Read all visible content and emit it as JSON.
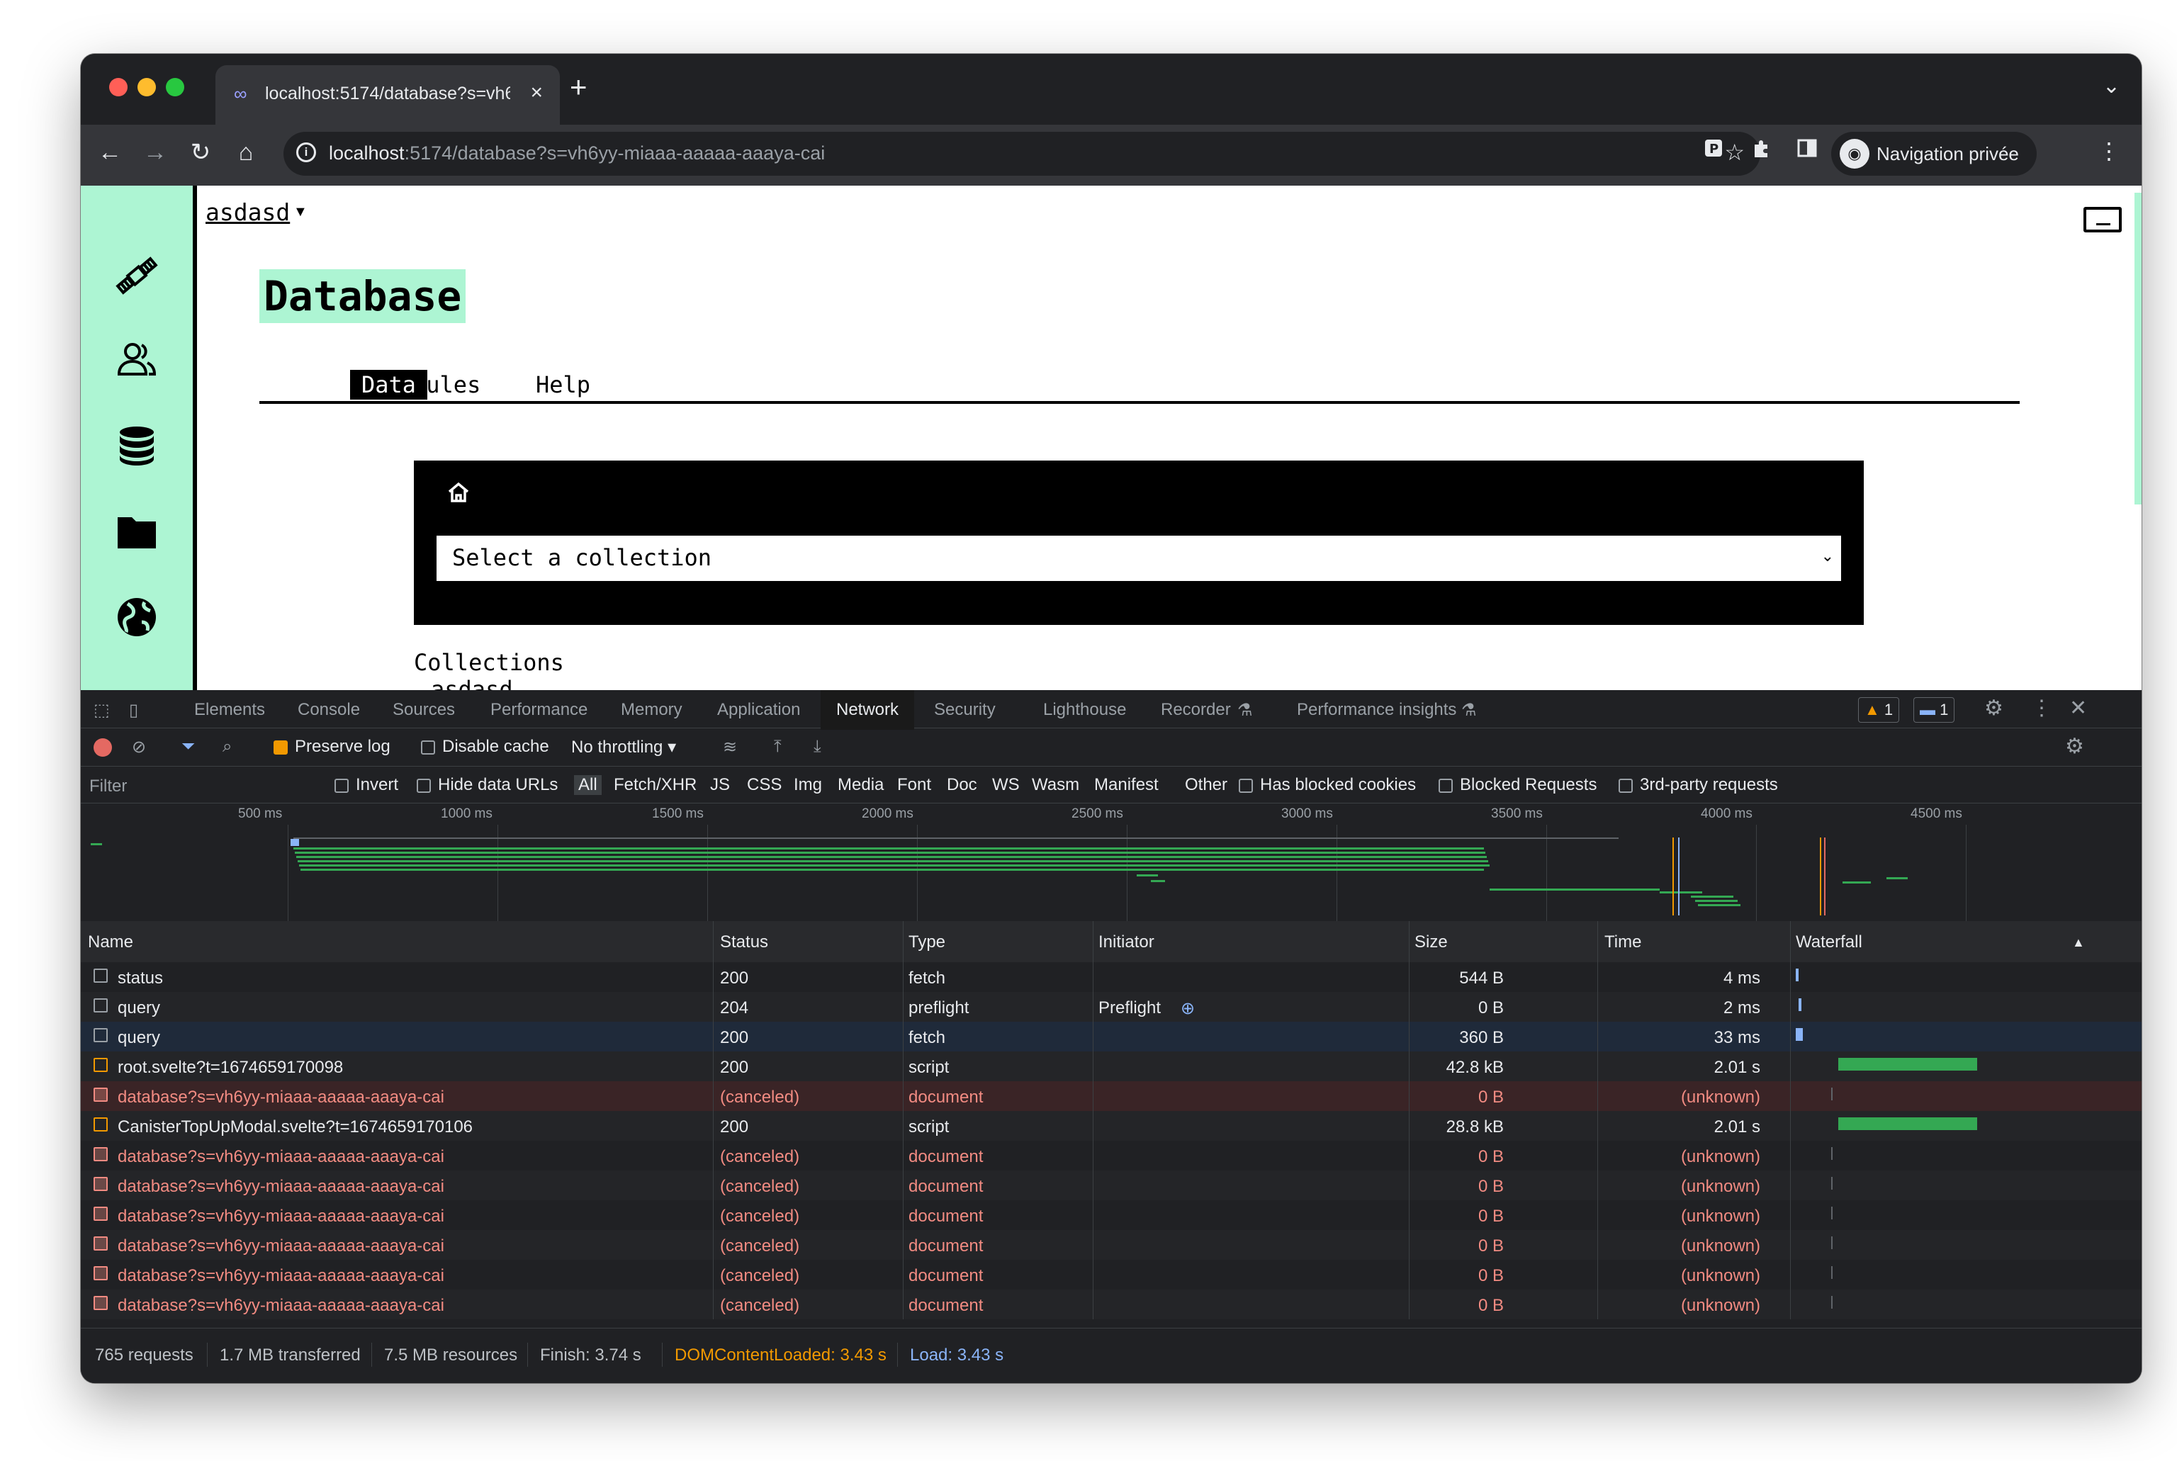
{
  "browser": {
    "tab_title": "localhost:5174/database?s=vh6",
    "url_host": "localhost",
    "url_rest": ":5174/database?s=vh6yy-miaaa-aaaaa-aaaya-cai",
    "profile_label": "Navigation privée"
  },
  "app": {
    "breadcrumb": "asdasd",
    "title": "Database",
    "tabs": [
      {
        "label": "Data",
        "active": true
      },
      {
        "label": "Rules",
        "active": false
      },
      {
        "label": "Help",
        "active": false
      }
    ],
    "select_placeholder": "Select a collection",
    "collections_label": "Collections",
    "partial_text": "asdasd",
    "accent": "#adf5d3"
  },
  "devtools": {
    "tabs": [
      "Elements",
      "Console",
      "Sources",
      "Performance",
      "Memory",
      "Application",
      "Network",
      "Security",
      "Lighthouse",
      "Recorder",
      "Performance insights"
    ],
    "active_tab": "Network",
    "warnings_count": "1",
    "messages_count": "1",
    "preserve_log": "Preserve log",
    "disable_cache": "Disable cache",
    "throttling": "No throttling",
    "filter_placeholder": "Filter",
    "invert": "Invert",
    "hide_data_urls": "Hide data URLs",
    "type_filters": [
      "All",
      "Fetch/XHR",
      "JS",
      "CSS",
      "Img",
      "Media",
      "Font",
      "Doc",
      "WS",
      "Wasm",
      "Manifest",
      "Other"
    ],
    "has_blocked_cookies": "Has blocked cookies",
    "blocked_requests": "Blocked Requests",
    "third_party": "3rd-party requests",
    "ticks": [
      "500 ms",
      "1000 ms",
      "1500 ms",
      "2000 ms",
      "2500 ms",
      "3000 ms",
      "3500 ms",
      "4000 ms",
      "4500 ms"
    ],
    "columns": [
      "Name",
      "Status",
      "Type",
      "Initiator",
      "Size",
      "Time",
      "Waterfall"
    ],
    "rows": [
      {
        "name": "status",
        "status": "200",
        "type": "fetch",
        "initiator": "",
        "size": "544 B",
        "time": "4 ms",
        "kind": "fetch"
      },
      {
        "name": "query",
        "status": "204",
        "type": "preflight",
        "initiator": "Preflight",
        "size": "0 B",
        "time": "2 ms",
        "kind": "fetch"
      },
      {
        "name": "query",
        "status": "200",
        "type": "fetch",
        "initiator": "",
        "size": "360 B",
        "time": "33 ms",
        "kind": "fetch"
      },
      {
        "name": "root.svelte?t=1674659170098",
        "status": "200",
        "type": "script",
        "initiator": "",
        "size": "42.8 kB",
        "time": "2.01 s",
        "kind": "script"
      },
      {
        "name": "database?s=vh6yy-miaaa-aaaaa-aaaya-cai",
        "status": "(canceled)",
        "type": "document",
        "initiator": "",
        "size": "0 B",
        "time": "(unknown)",
        "kind": "error"
      },
      {
        "name": "CanisterTopUpModal.svelte?t=1674659170106",
        "status": "200",
        "type": "script",
        "initiator": "",
        "size": "28.8 kB",
        "time": "2.01 s",
        "kind": "script"
      },
      {
        "name": "database?s=vh6yy-miaaa-aaaaa-aaaya-cai",
        "status": "(canceled)",
        "type": "document",
        "initiator": "",
        "size": "0 B",
        "time": "(unknown)",
        "kind": "error"
      },
      {
        "name": "database?s=vh6yy-miaaa-aaaaa-aaaya-cai",
        "status": "(canceled)",
        "type": "document",
        "initiator": "",
        "size": "0 B",
        "time": "(unknown)",
        "kind": "error"
      },
      {
        "name": "database?s=vh6yy-miaaa-aaaaa-aaaya-cai",
        "status": "(canceled)",
        "type": "document",
        "initiator": "",
        "size": "0 B",
        "time": "(unknown)",
        "kind": "error"
      },
      {
        "name": "database?s=vh6yy-miaaa-aaaaa-aaaya-cai",
        "status": "(canceled)",
        "type": "document",
        "initiator": "",
        "size": "0 B",
        "time": "(unknown)",
        "kind": "error"
      },
      {
        "name": "database?s=vh6yy-miaaa-aaaaa-aaaya-cai",
        "status": "(canceled)",
        "type": "document",
        "initiator": "",
        "size": "0 B",
        "time": "(unknown)",
        "kind": "error"
      },
      {
        "name": "database?s=vh6yy-miaaa-aaaaa-aaaya-cai",
        "status": "(canceled)",
        "type": "document",
        "initiator": "",
        "size": "0 B",
        "time": "(unknown)",
        "kind": "error"
      }
    ],
    "summary": {
      "requests": "765 requests",
      "transferred": "1.7 MB transferred",
      "resources": "7.5 MB resources",
      "finish": "Finish: 3.74 s",
      "dom": "DOMContentLoaded: 3.43 s",
      "load": "Load: 3.43 s"
    },
    "colors": {
      "error": "#f28b82",
      "dom": "#f29900",
      "load": "#8ab4f8",
      "bar": "#34a853"
    }
  }
}
